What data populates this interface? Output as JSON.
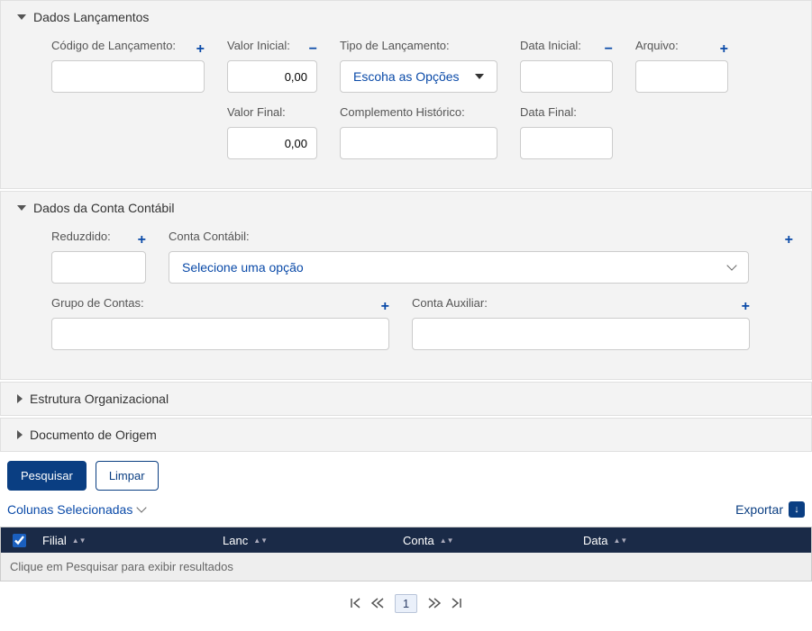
{
  "sections": {
    "lancamentos": {
      "title": "Dados Lançamentos",
      "fields": {
        "codigo_label": "Código de Lançamento:",
        "codigo_value": "",
        "valor_inicial_label": "Valor Inicial:",
        "valor_inicial_value": "0,00",
        "tipo_label": "Tipo de Lançamento:",
        "tipo_placeholder": "Escoha as Opções",
        "data_inicial_label": "Data Inicial:",
        "data_inicial_value": "",
        "arquivo_label": "Arquivo:",
        "arquivo_value": "",
        "valor_final_label": "Valor Final:",
        "valor_final_value": "0,00",
        "complemento_label": "Complemento Histórico:",
        "complemento_value": "",
        "data_final_label": "Data Final:",
        "data_final_value": ""
      }
    },
    "conta": {
      "title": "Dados da Conta Contábil",
      "fields": {
        "reduzido_label": "Reduzdido:",
        "reduzido_value": "",
        "conta_contabil_label": "Conta Contábil:",
        "conta_contabil_placeholder": "Selecione uma opção",
        "grupo_contas_label": "Grupo de Contas:",
        "grupo_contas_value": "",
        "conta_aux_label": "Conta Auxiliar:",
        "conta_aux_value": ""
      }
    },
    "estrutura": {
      "title": "Estrutura Organizacional"
    },
    "documento": {
      "title": "Documento de Origem"
    }
  },
  "buttons": {
    "pesquisar": "Pesquisar",
    "limpar": "Limpar"
  },
  "toolbar": {
    "colunas": "Colunas Selecionadas",
    "exportar": "Exportar"
  },
  "table": {
    "columns": {
      "filial": "Filial",
      "lanc": "Lanc",
      "conta": "Conta",
      "data": "Data"
    },
    "empty_message": "Clique em Pesquisar para exibir resultados"
  },
  "pagination": {
    "page": "1"
  },
  "glyphs": {
    "plus": "+",
    "minus": "−",
    "download": "↓"
  }
}
